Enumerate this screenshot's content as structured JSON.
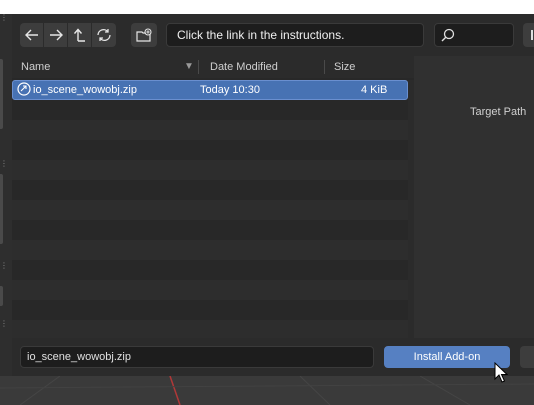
{
  "header": {
    "path_value": "Click the link in the instructions.",
    "nav_icons": [
      "arrow-left-icon",
      "arrow-right-icon",
      "parent-directory-icon",
      "refresh-icon"
    ],
    "new_folder_icon": "new-folder-icon",
    "search_icon": "search-icon"
  },
  "columns": {
    "name": "Name",
    "date": "Date Modified",
    "size": "Size"
  },
  "files": [
    {
      "name": "io_scene_wowobj.zip",
      "date": "Today 10:30",
      "size": "4 KiB",
      "selected": true
    }
  ],
  "right_panel": {
    "target_path_label": "Target Path"
  },
  "footer": {
    "filename_value": "io_scene_wowobj.zip",
    "install_label": "Install Add-on"
  },
  "colors": {
    "accent": "#5680c2",
    "selection": "#4772b3",
    "background": "#2b2b2b"
  }
}
